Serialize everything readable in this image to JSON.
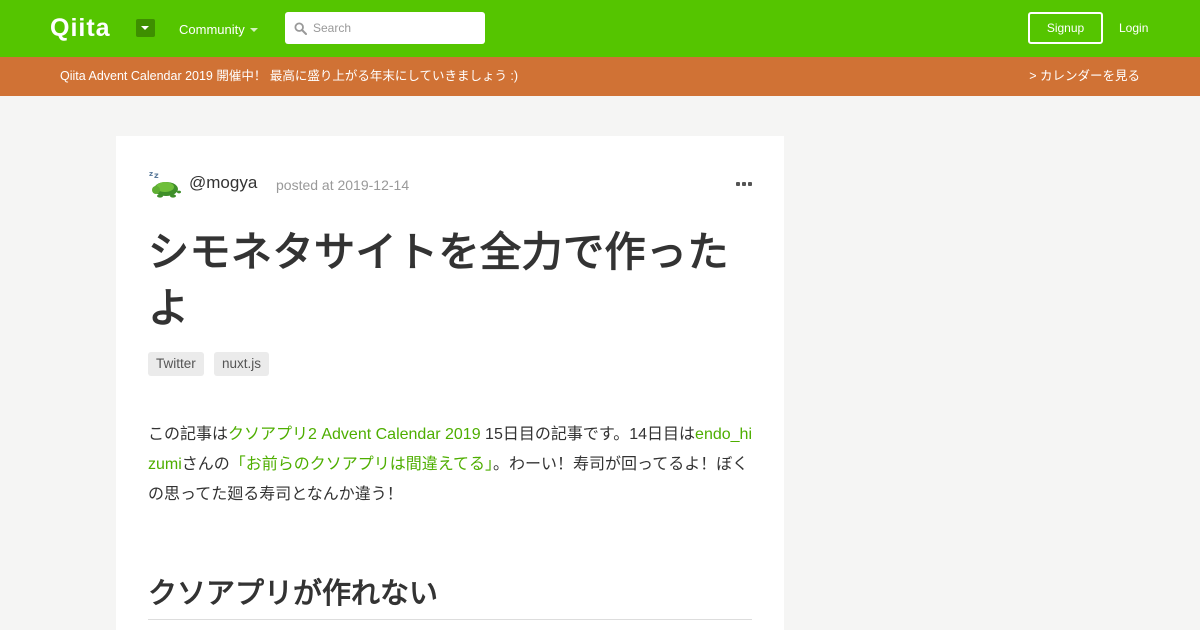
{
  "header": {
    "logo_text": "Qiita",
    "community_label": "Community",
    "search": {
      "placeholder": "Search",
      "value": ""
    },
    "signup_label": "Signup",
    "login_label": "Login",
    "colors": {
      "header_bg": "#55c500",
      "banner_bg": "#d07235",
      "link": "#4eae00"
    }
  },
  "banner": {
    "text": "Qiita Advent Calendar 2019 開催中！ 最高に盛り上がる年末にしていきましょう :)",
    "link_label": "> カレンダーを見る"
  },
  "article": {
    "author": "@mogya",
    "avatar_icon": "sleeping-turtle-avatar-icon",
    "posted": "posted at 2019-12-14",
    "title": "シモネタサイトを全力で作ったよ",
    "tags": [
      "Twitter",
      "nuxt.js"
    ],
    "intro": {
      "t1": "この記事は",
      "link1": "クソアプリ2 Advent Calendar 2019",
      "t2": " 15日目の記事です。14日目は",
      "link2": "endo_hizumi",
      "t3": "さんの",
      "link3": "「お前らのクソアプリは間違えてる」",
      "t4": "。わーい！寿司が回ってるよ！ぼくの思ってた廻る寿司となんか違う！"
    },
    "section_heading": "クソアプリが作れない"
  }
}
